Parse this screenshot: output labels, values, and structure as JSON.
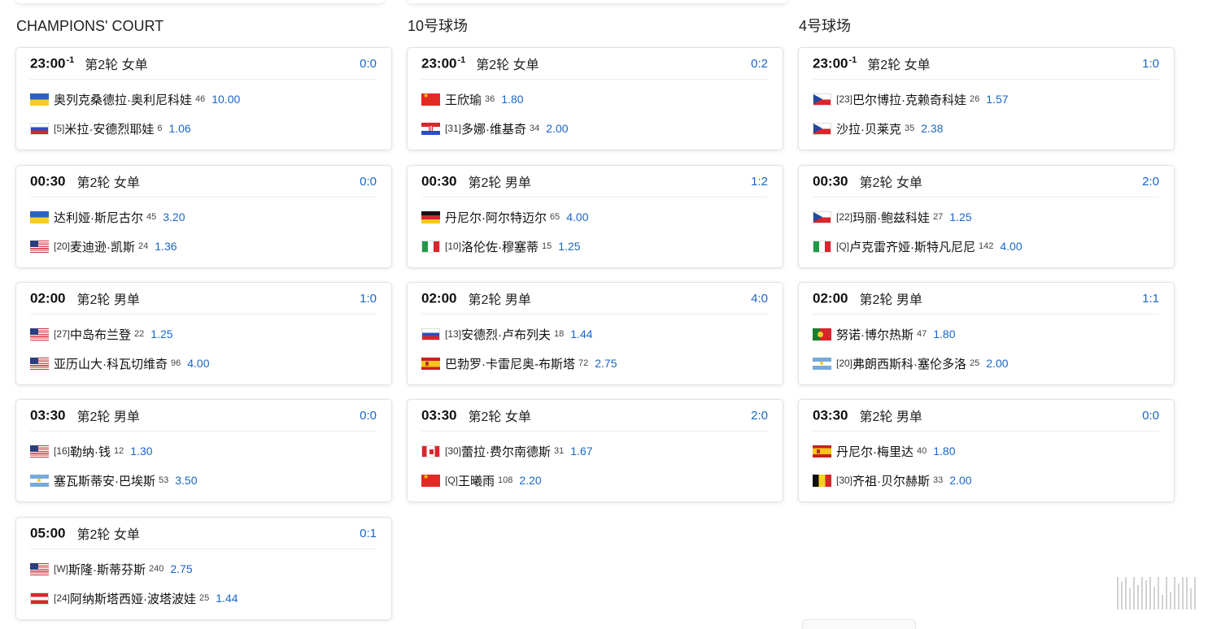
{
  "columns": [
    {
      "title": "CHAMPIONS' COURT",
      "matches": [
        {
          "time": "23:00",
          "time_sup": "-1",
          "round": "第2轮 女单",
          "score": "0:0",
          "p1": {
            "flag": "ua",
            "seed": "",
            "name": "奥列克桑德拉·奥利尼科娃",
            "rank": "46",
            "odds": "10.00"
          },
          "p2": {
            "flag": "ru",
            "seed": "[5]",
            "name": "米拉·安德烈耶娃",
            "rank": "6",
            "odds": "1.06"
          }
        },
        {
          "time": "00:30",
          "time_sup": "",
          "round": "第2轮 女单",
          "score": "0:0",
          "p1": {
            "flag": "ua",
            "seed": "",
            "name": "达利娅·斯尼古尔",
            "rank": "45",
            "odds": "3.20"
          },
          "p2": {
            "flag": "us",
            "seed": "[20]",
            "name": "麦迪逊·凯斯",
            "rank": "24",
            "odds": "1.36"
          }
        },
        {
          "time": "02:00",
          "time_sup": "",
          "round": "第2轮 男单",
          "score": "1:0",
          "p1": {
            "flag": "us",
            "seed": "[27]",
            "name": "中岛布兰登",
            "rank": "22",
            "odds": "1.25"
          },
          "p2": {
            "flag": "us",
            "seed": "",
            "name": "亚历山大·科瓦切维奇",
            "rank": "96",
            "odds": "4.00"
          }
        },
        {
          "time": "03:30",
          "time_sup": "",
          "round": "第2轮 男单",
          "score": "0:0",
          "p1": {
            "flag": "us",
            "seed": "[16]",
            "name": "勒纳·钱",
            "rank": "12",
            "odds": "1.30"
          },
          "p2": {
            "flag": "ar",
            "seed": "",
            "name": "塞瓦斯蒂安·巴埃斯",
            "rank": "53",
            "odds": "3.50"
          }
        },
        {
          "time": "05:00",
          "time_sup": "",
          "round": "第2轮 女单",
          "score": "0:1",
          "p1": {
            "flag": "us",
            "seed": "[W]",
            "name": "斯隆·斯蒂芬斯",
            "rank": "240",
            "odds": "2.75"
          },
          "p2": {
            "flag": "at",
            "seed": "[24]",
            "name": "阿纳斯塔西娅·波塔波娃",
            "rank": "25",
            "odds": "1.44"
          }
        }
      ]
    },
    {
      "title": "10号球场",
      "matches": [
        {
          "time": "23:00",
          "time_sup": "-1",
          "round": "第2轮 女单",
          "score": "0:2",
          "p1": {
            "flag": "cn",
            "seed": "",
            "name": "王欣瑜",
            "rank": "36",
            "odds": "1.80"
          },
          "p2": {
            "flag": "hr",
            "seed": "[31]",
            "name": "多娜·维基奇",
            "rank": "34",
            "odds": "2.00"
          }
        },
        {
          "time": "00:30",
          "time_sup": "",
          "round": "第2轮 男单",
          "score": "1:2",
          "p1": {
            "flag": "de",
            "seed": "",
            "name": "丹尼尔·阿尔特迈尔",
            "rank": "65",
            "odds": "4.00"
          },
          "p2": {
            "flag": "it",
            "seed": "[10]",
            "name": "洛伦佐·穆塞蒂",
            "rank": "15",
            "odds": "1.25"
          }
        },
        {
          "time": "02:00",
          "time_sup": "",
          "round": "第2轮 男单",
          "score": "4:0",
          "p1": {
            "flag": "ru",
            "seed": "[13]",
            "name": "安德烈·卢布列夫",
            "rank": "18",
            "odds": "1.44"
          },
          "p2": {
            "flag": "es",
            "seed": "",
            "name": "巴勃罗·卡雷尼奥-布斯塔",
            "rank": "72",
            "odds": "2.75"
          }
        },
        {
          "time": "03:30",
          "time_sup": "",
          "round": "第2轮 女单",
          "score": "2:0",
          "p1": {
            "flag": "ca",
            "seed": "[30]",
            "name": "蕾拉·费尔南德斯",
            "rank": "31",
            "odds": "1.67"
          },
          "p2": {
            "flag": "cn",
            "seed": "[Q]",
            "name": "王曦雨",
            "rank": "108",
            "odds": "2.20"
          }
        }
      ]
    },
    {
      "title": "4号球场",
      "matches": [
        {
          "time": "23:00",
          "time_sup": "-1",
          "round": "第2轮 女单",
          "score": "1:0",
          "p1": {
            "flag": "cz",
            "seed": "[23]",
            "name": "巴尔博拉·克赖奇科娃",
            "rank": "26",
            "odds": "1.57"
          },
          "p2": {
            "flag": "cz",
            "seed": "",
            "name": "沙拉·贝莱克",
            "rank": "35",
            "odds": "2.38"
          }
        },
        {
          "time": "00:30",
          "time_sup": "",
          "round": "第2轮 女单",
          "score": "2:0",
          "p1": {
            "flag": "cz",
            "seed": "[22]",
            "name": "玛丽·鲍兹科娃",
            "rank": "27",
            "odds": "1.25"
          },
          "p2": {
            "flag": "it",
            "seed": "[Q]",
            "name": "卢克雷齐娅·斯特凡尼尼",
            "rank": "142",
            "odds": "4.00"
          }
        },
        {
          "time": "02:00",
          "time_sup": "",
          "round": "第2轮 男单",
          "score": "1:1",
          "p1": {
            "flag": "pt",
            "seed": "",
            "name": "努诺·博尔热斯",
            "rank": "47",
            "odds": "1.80"
          },
          "p2": {
            "flag": "ar",
            "seed": "[20]",
            "name": "弗朗西斯科·塞伦多洛",
            "rank": "25",
            "odds": "2.00"
          }
        },
        {
          "time": "03:30",
          "time_sup": "",
          "round": "第2轮 男单",
          "score": "0:0",
          "p1": {
            "flag": "es",
            "seed": "",
            "name": "丹尼尔·梅里达",
            "rank": "40",
            "odds": "1.80"
          },
          "p2": {
            "flag": "be",
            "seed": "[30]",
            "name": "齐祖·贝尔赫斯",
            "rank": "33",
            "odds": "2.00"
          }
        }
      ]
    }
  ],
  "colors": {
    "accent": "#1a66c8",
    "card_border": "#e3e3e3"
  }
}
